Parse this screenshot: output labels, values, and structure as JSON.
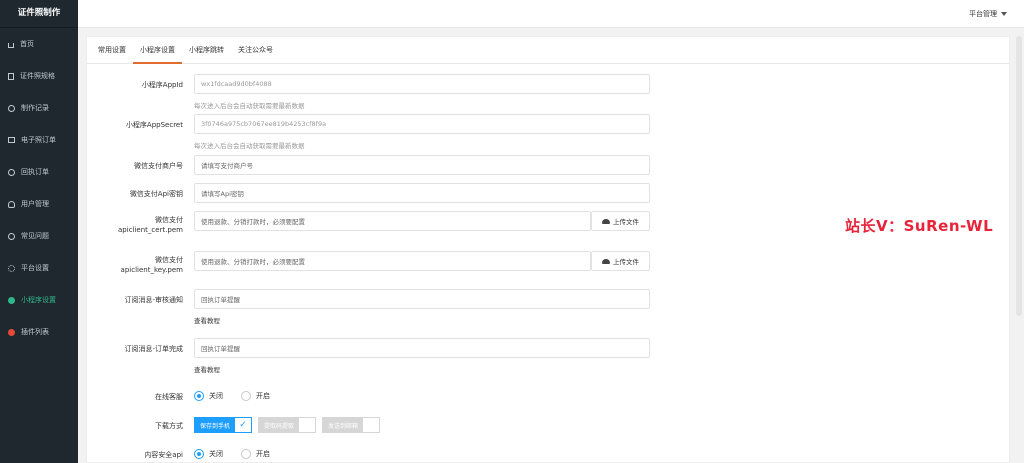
{
  "app": {
    "title": "证件照制作"
  },
  "sidebar": {
    "items": [
      {
        "label": "首页",
        "icon": "home-icon"
      },
      {
        "label": "证件照规格",
        "icon": "document-icon"
      },
      {
        "label": "制作记录",
        "icon": "clock-icon"
      },
      {
        "label": "电子照订单",
        "icon": "grid-icon"
      },
      {
        "label": "回执订单",
        "icon": "cart-icon"
      },
      {
        "label": "用户管理",
        "icon": "user-icon"
      },
      {
        "label": "常见问题",
        "icon": "help-icon"
      },
      {
        "label": "平台设置",
        "icon": "gear-icon"
      },
      {
        "label": "小程序设置",
        "icon": "miniprogram-icon",
        "active": true
      },
      {
        "label": "插件列表",
        "icon": "plugin-icon"
      }
    ],
    "active_color": "#2fb88c"
  },
  "header": {
    "platform_menu": "平台管理"
  },
  "tabs": [
    {
      "label": "常用设置"
    },
    {
      "label": "小程序设置",
      "active": true
    },
    {
      "label": "小程序跳转"
    },
    {
      "label": "关注公众号"
    }
  ],
  "form": {
    "appid": {
      "label": "小程序AppId",
      "value": "wx1fdcaad9d0bf4088",
      "hint": "每次进入后台会自动获取需要最新数据"
    },
    "appsecret": {
      "label": "小程序AppSecret",
      "value": "3f0746a975cb7067ee819b4253cf8f9a",
      "hint": "每次进入后台会自动获取需要最新数据"
    },
    "mchid": {
      "label": "微信支付商户号",
      "placeholder": "请填写支付商户号"
    },
    "apikey": {
      "label": "微信支付Api密钥",
      "placeholder": "请填写Api密钥"
    },
    "cert": {
      "label_line1": "微信支付",
      "label_line2": "apiclient_cert.pem",
      "placeholder": "使用退款、分销打款时，必须要配置",
      "upload": "上传文件"
    },
    "key": {
      "label_line1": "微信支付",
      "label_line2": "apiclient_key.pem",
      "placeholder": "使用退款、分销打款时，必须要配置",
      "upload": "上传文件"
    },
    "sub_audit": {
      "label": "订阅消息-审核通知",
      "placeholder": "回执订单提醒",
      "link": "查看教程"
    },
    "sub_done": {
      "label": "订阅消息-订单完成",
      "placeholder": "回执订单提醒",
      "link": "查看教程"
    },
    "service": {
      "label": "在线客服",
      "options": [
        "关闭",
        "开启"
      ],
      "selected": 0
    },
    "download": {
      "label": "下载方式",
      "options": [
        "保存到手机",
        "提取码提取",
        "发送到邮箱"
      ],
      "selected": 0
    },
    "security": {
      "label": "内容安全api",
      "options": [
        "关闭",
        "开启"
      ],
      "selected": 0
    }
  },
  "watermark": "站长V：SuRen-WL",
  "colors": {
    "accent": "#1e9fff",
    "tab_underline": "#e06c2e",
    "sidebar_bg": "#20282f",
    "watermark": "#e8233a"
  }
}
